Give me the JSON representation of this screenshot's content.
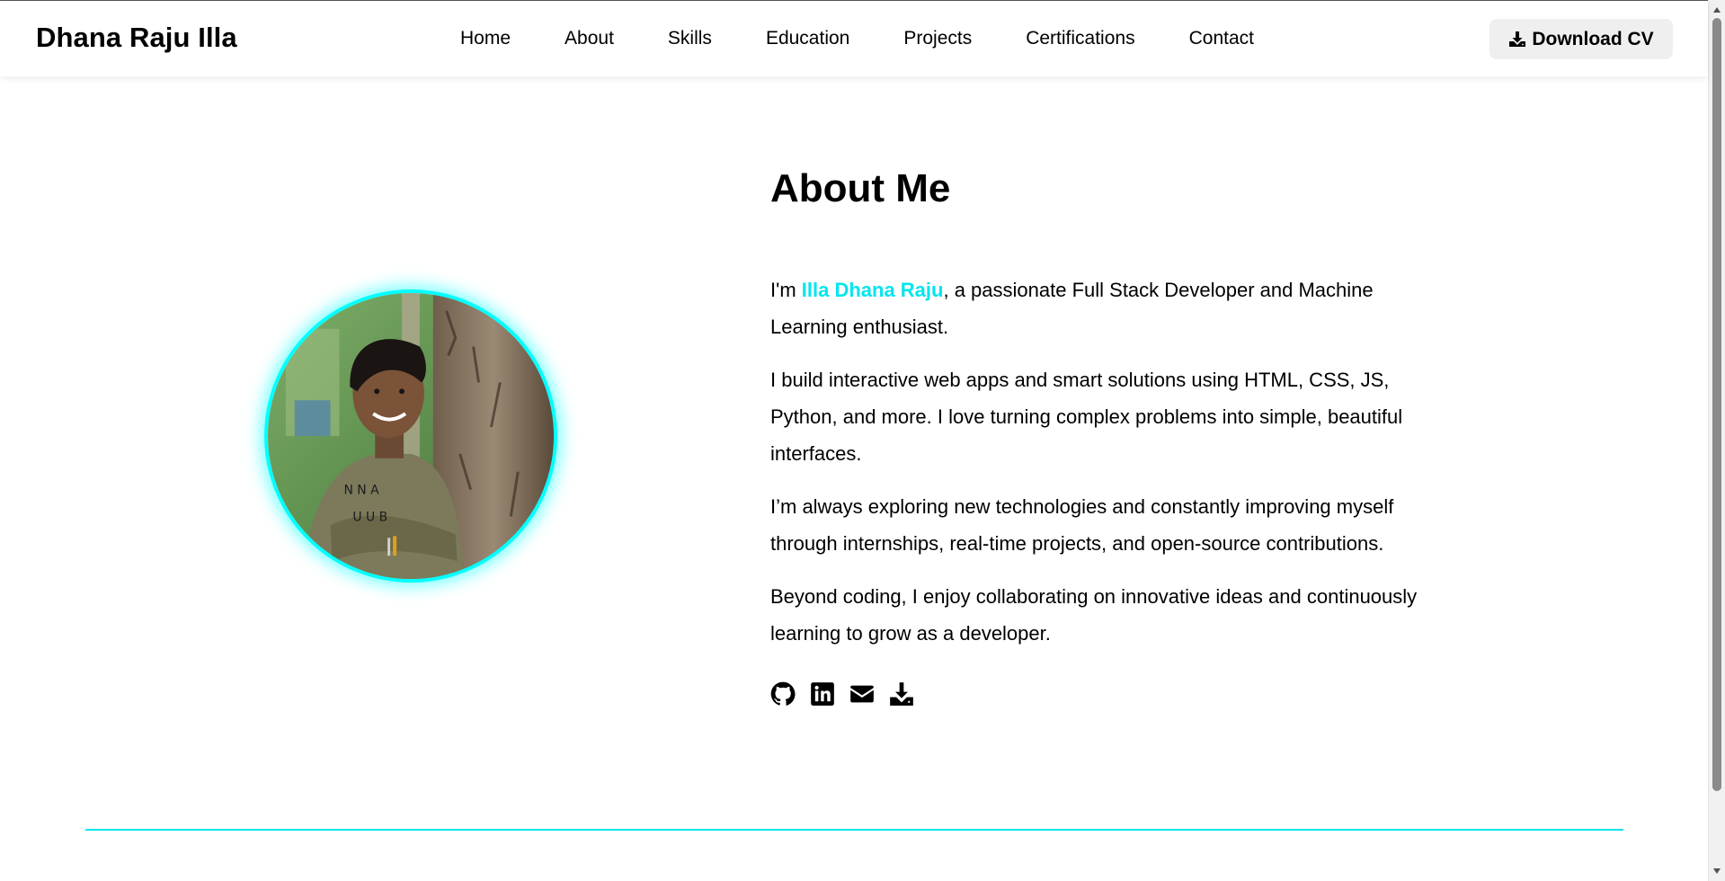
{
  "header": {
    "brand": "Dhana Raju Illa",
    "nav": [
      "Home",
      "About",
      "Skills",
      "Education",
      "Projects",
      "Certifications",
      "Contact"
    ],
    "cv_button": "Download CV"
  },
  "about": {
    "title": "About Me",
    "intro_prefix": "I'm ",
    "intro_name": "Illa Dhana Raju",
    "intro_suffix": ", a passionate Full Stack Developer and Machine Learning enthusiast.",
    "p2": "I build interactive web apps and smart solutions using HTML, CSS, JS, Python, and more. I love turning complex problems into simple, beautiful interfaces.",
    "p3": "I’m always exploring new technologies and constantly improving myself through internships, real-time projects, and open-source contributions.",
    "p4": "Beyond coding, I enjoy collaborating on innovative ideas and continuously learning to grow as a developer."
  },
  "socials": [
    "github-icon",
    "linkedin-icon",
    "envelope-icon",
    "download-icon"
  ],
  "colors": {
    "accent": "#00e5ee",
    "ring": "#00ffff",
    "text": "#000000",
    "button_bg": "#efefef"
  }
}
